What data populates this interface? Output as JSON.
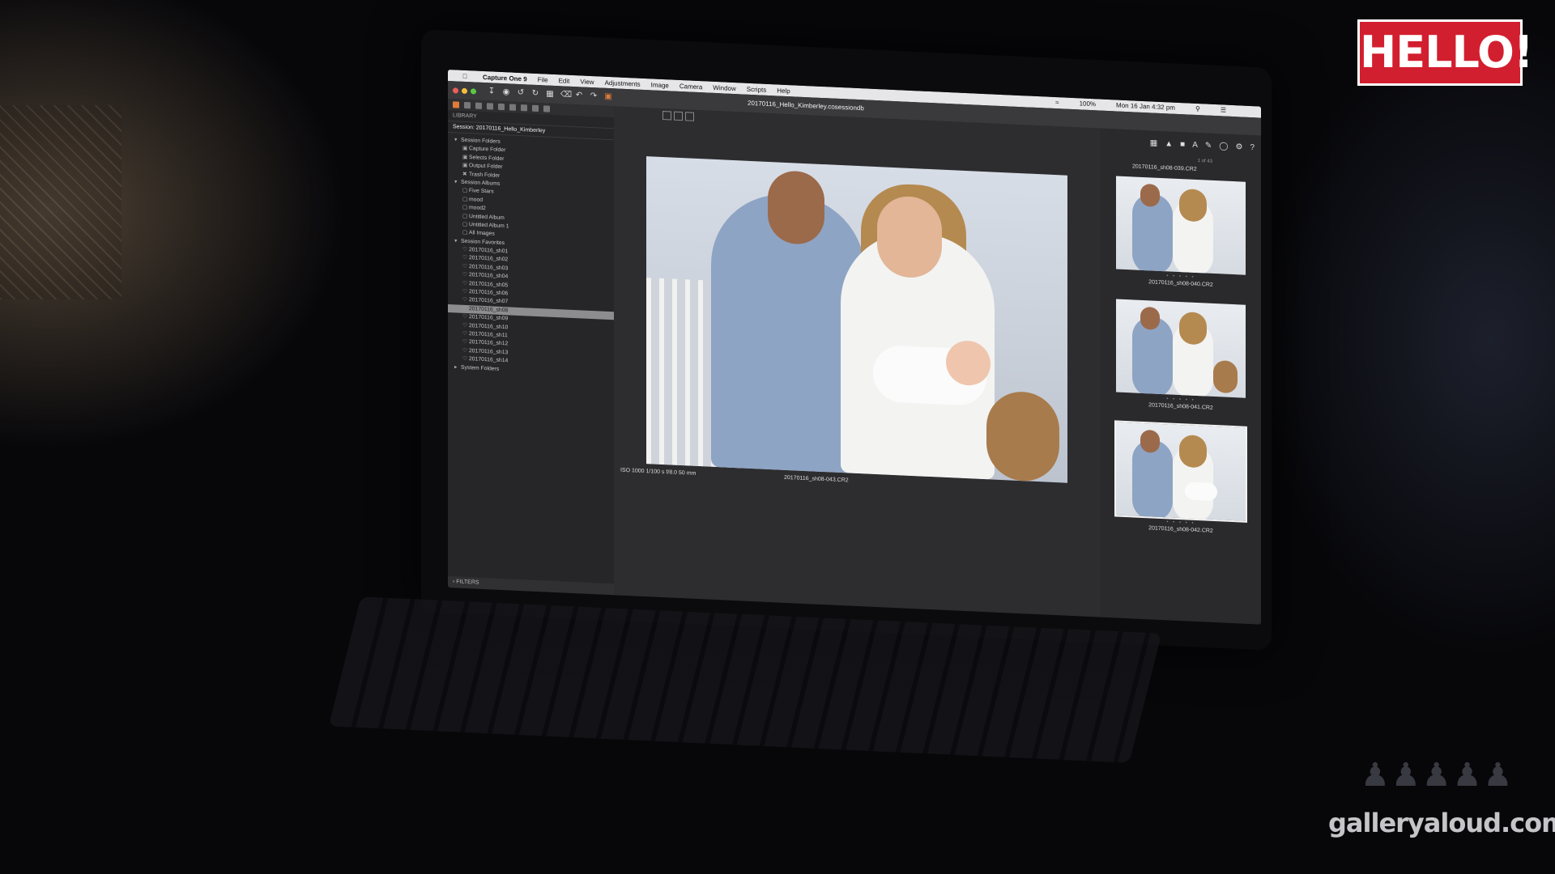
{
  "overlay": {
    "brand_logo": "HELLO!",
    "watermark": "galleryaloud.com"
  },
  "menubar": {
    "app_name": "Capture One 9",
    "items": [
      "File",
      "Edit",
      "View",
      "Adjustments",
      "Image",
      "Camera",
      "Window",
      "Scripts",
      "Help"
    ],
    "battery": "100%",
    "clock": "Mon 16 Jan  4:32 pm"
  },
  "window": {
    "session_title": "20170116_Hello_Kimberley.cosessiondb"
  },
  "library": {
    "panel_label": "LIBRARY",
    "session_name": "Session: 20170116_Hello_Kimberley",
    "tree": [
      {
        "label": "Session Folders",
        "level": 0,
        "icon": "chevron-down"
      },
      {
        "label": "Capture Folder",
        "level": 1,
        "icon": "folder"
      },
      {
        "label": "Selects Folder",
        "level": 1,
        "icon": "folder"
      },
      {
        "label": "Output Folder",
        "level": 1,
        "icon": "folder"
      },
      {
        "label": "Trash Folder",
        "level": 1,
        "icon": "trash"
      },
      {
        "label": "Session Albums",
        "level": 0,
        "icon": "chevron-down"
      },
      {
        "label": "Five Stars",
        "level": 1,
        "icon": "album"
      },
      {
        "label": "mood",
        "level": 1,
        "icon": "album"
      },
      {
        "label": "mood2",
        "level": 1,
        "icon": "album"
      },
      {
        "label": "Untitled Album",
        "level": 1,
        "icon": "album"
      },
      {
        "label": "Untitled Album 1",
        "level": 1,
        "icon": "album"
      },
      {
        "label": "All Images",
        "level": 1,
        "icon": "album"
      },
      {
        "label": "Session Favorites",
        "level": 0,
        "icon": "chevron-down"
      },
      {
        "label": "20170116_sh01",
        "level": 1,
        "icon": "heart"
      },
      {
        "label": "20170116_sh02",
        "level": 1,
        "icon": "heart"
      },
      {
        "label": "20170116_sh03",
        "level": 1,
        "icon": "heart"
      },
      {
        "label": "20170116_sh04",
        "level": 1,
        "icon": "heart"
      },
      {
        "label": "20170116_sh05",
        "level": 1,
        "icon": "heart"
      },
      {
        "label": "20170116_sh06",
        "level": 1,
        "icon": "heart"
      },
      {
        "label": "20170116_sh07",
        "level": 1,
        "icon": "heart"
      },
      {
        "label": "20170116_sh08",
        "level": 1,
        "icon": "heart",
        "selected": true
      },
      {
        "label": "20170116_sh09",
        "level": 1,
        "icon": "heart"
      },
      {
        "label": "20170116_sh10",
        "level": 1,
        "icon": "heart"
      },
      {
        "label": "20170116_sh11",
        "level": 1,
        "icon": "heart"
      },
      {
        "label": "20170116_sh12",
        "level": 1,
        "icon": "heart"
      },
      {
        "label": "20170116_sh13",
        "level": 1,
        "icon": "heart"
      },
      {
        "label": "20170116_sh14",
        "level": 1,
        "icon": "heart"
      },
      {
        "label": "System Folders",
        "level": 0,
        "icon": "chevron-right"
      }
    ],
    "filters_label": "FILTERS"
  },
  "viewer": {
    "meta": "ISO 1000   1/100 s   f/8.0   50 mm",
    "filename": "20170116_sh08-043.CR2"
  },
  "browser": {
    "counter": "1 of 43",
    "top_filename": "20170116_sh08-039.CR2",
    "thumbnails": [
      {
        "label": "20170116_sh08-040.CR2",
        "selected": false
      },
      {
        "label": "20170116_sh08-041.CR2",
        "selected": false
      },
      {
        "label": "20170116_sh08-042.CR2",
        "selected": true
      }
    ],
    "stars": "• • • • •"
  },
  "colors": {
    "accent": "#e07b39",
    "brand_red": "#d21f2f",
    "panel_bg": "#262629"
  }
}
